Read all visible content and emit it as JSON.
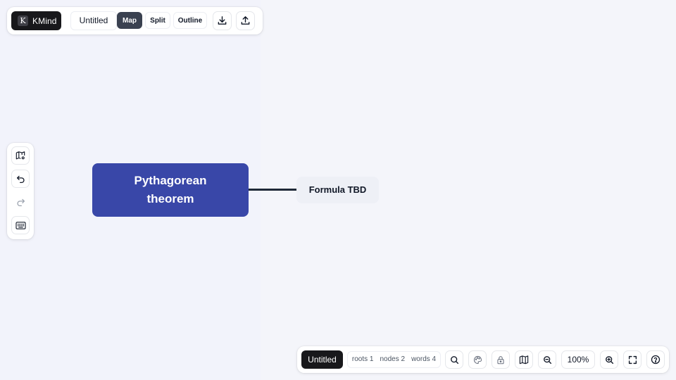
{
  "app": {
    "brand_logo_letter": "K",
    "brand_name": "KMind",
    "document_title": "Untitled"
  },
  "toolbar": {
    "views": [
      {
        "label": "Map",
        "active": true
      },
      {
        "label": "Split",
        "active": false
      },
      {
        "label": "Outline",
        "active": false
      }
    ],
    "icons": [
      "download-icon",
      "upload-icon"
    ]
  },
  "left_toolbar": {
    "icons": [
      "map-settings-icon",
      "undo-icon",
      "redo-icon",
      "keyboard-icon"
    ],
    "redo_disabled": true
  },
  "mindmap": {
    "root": {
      "text": "Pythagorean theorem",
      "color": "#3947a8"
    },
    "children": [
      {
        "text": "Formula TBD"
      }
    ]
  },
  "bottom_bar": {
    "title": "Untitled",
    "stats": {
      "roots": "roots 1",
      "nodes": "nodes 2",
      "words": "words 4"
    },
    "icons": [
      "search-icon",
      "theme-palette-icon",
      "lock-icon",
      "minimap-icon",
      "zoom-out-icon",
      "zoom-in-icon",
      "fullscreen-icon",
      "help-icon"
    ],
    "zoom": "100%"
  },
  "colors": {
    "background": "#f4f5fa",
    "dark": "#18181b",
    "active_segment": "#3a4150",
    "root_node": "#3947a8",
    "child_node": "#eef0f6"
  }
}
